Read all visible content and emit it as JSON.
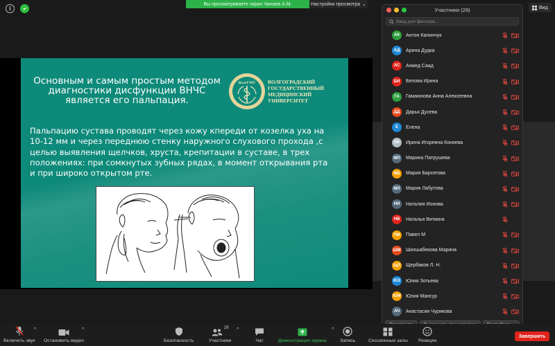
{
  "top_bar": {
    "share_banner": "Вы просматриваете экран Чинаев А.М.",
    "share_settings": "Настройки просмотра",
    "view_button": "Вид"
  },
  "slide": {
    "title": "Основным и самым простым методом диагностики дисфункции ВНЧС является его пальпация.",
    "logo_emblem_text": "ВолгГМУ",
    "logo_lines": [
      "ВОЛГОГРАДСКИЙ",
      "ГОСУДАРСТВЕННЫЙ",
      "МЕДИЦИНСКИЙ",
      "УНИВЕРСИТЕТ"
    ],
    "body": "Пальпацию сустава проводят через кожу кпереди от козелка уха на 10-12 мм и через переднюю стенку наружного слухового прохода ,с целью выявления щелчков, хруста, крепитации в суставе, в трех положениях: при сомкнутых зубных рядах, в момент открывания рта и при широко открытом рте."
  },
  "participants_panel": {
    "title": "Участники (28)",
    "filter_placeholder": "Ввод для фильтра...",
    "participants": [
      {
        "initials": "АК",
        "name": "Антон Калинчук",
        "color": "#2e9e3e",
        "camera_off": true
      },
      {
        "initials": "АД",
        "name": "Арина Дудка",
        "color": "#1e88d6",
        "camera_off": true
      },
      {
        "initials": "АС",
        "name": "Ахмед Саад",
        "color": "#e0241c",
        "camera_off": true
      },
      {
        "initials": "БИ",
        "name": "Белова Ирина",
        "color": "#e0241c",
        "camera_off": true
      },
      {
        "initials": "ГА",
        "name": "Гамаюнова Анна Алексеевна",
        "color": "#2e9e3e",
        "camera_off": true
      },
      {
        "initials": "ДД",
        "name": "Дарья Дусева",
        "color": "#e8491c",
        "camera_off": true
      },
      {
        "initials": "Е",
        "name": "Елена",
        "color": "#1e88d6",
        "camera_off": true
      },
      {
        "initials": "ИК",
        "name": "Ирина Игоревна Коняева",
        "color": "#b0bec5",
        "camera_off": true
      },
      {
        "initials": "МП",
        "name": "Марина Патрушева",
        "color": "#546a7b",
        "camera_off": true
      },
      {
        "initials": "МБ",
        "name": "Мария Барсегова",
        "color": "#f5a000",
        "camera_off": true
      },
      {
        "initials": "МЛ",
        "name": "Мария Лабутова",
        "color": "#546a7b",
        "camera_off": true
      },
      {
        "initials": "НИ",
        "name": "Наталия Ионова",
        "color": "#546a7b",
        "camera_off": true
      },
      {
        "initials": "НВ",
        "name": "Наталья Вяткина",
        "color": "#e0241c",
        "camera_off": false
      },
      {
        "initials": "ПМ",
        "name": "Павел М",
        "color": "#f5a000",
        "camera_off": true
      },
      {
        "initials": "ШМ",
        "name": "Шихшабекова Марина",
        "color": "#e8491c",
        "camera_off": true
      },
      {
        "initials": "ЩЛ",
        "name": "Щербаков Л. Н.",
        "color": "#f5a000",
        "camera_off": true
      },
      {
        "initials": "ЮЗ",
        "name": "Юлия Зотьева",
        "color": "#1e88d6",
        "camera_off": true
      },
      {
        "initials": "ЮМ",
        "name": "Юлия Мансур",
        "color": "#f5a000",
        "camera_off": true
      },
      {
        "initials": "АЧ",
        "name": "Анастасия Чурикова",
        "color": "#546a7b",
        "camera_off": true
      }
    ],
    "invite_button": "Пригласить",
    "mute_all_button": "Выключить звук для всех",
    "more_button": "Подробнее"
  },
  "toolbar": {
    "unmute": "Включить звук",
    "start_video": "Остановить видео",
    "security": "Безопасность",
    "participants": "Участники",
    "participants_count": "28",
    "chat": "Чат",
    "share_screen": "Демонстрация экрана",
    "record": "Запись",
    "breakout": "Сессионные залы",
    "reactions": "Реакции",
    "end": "Завершить"
  }
}
